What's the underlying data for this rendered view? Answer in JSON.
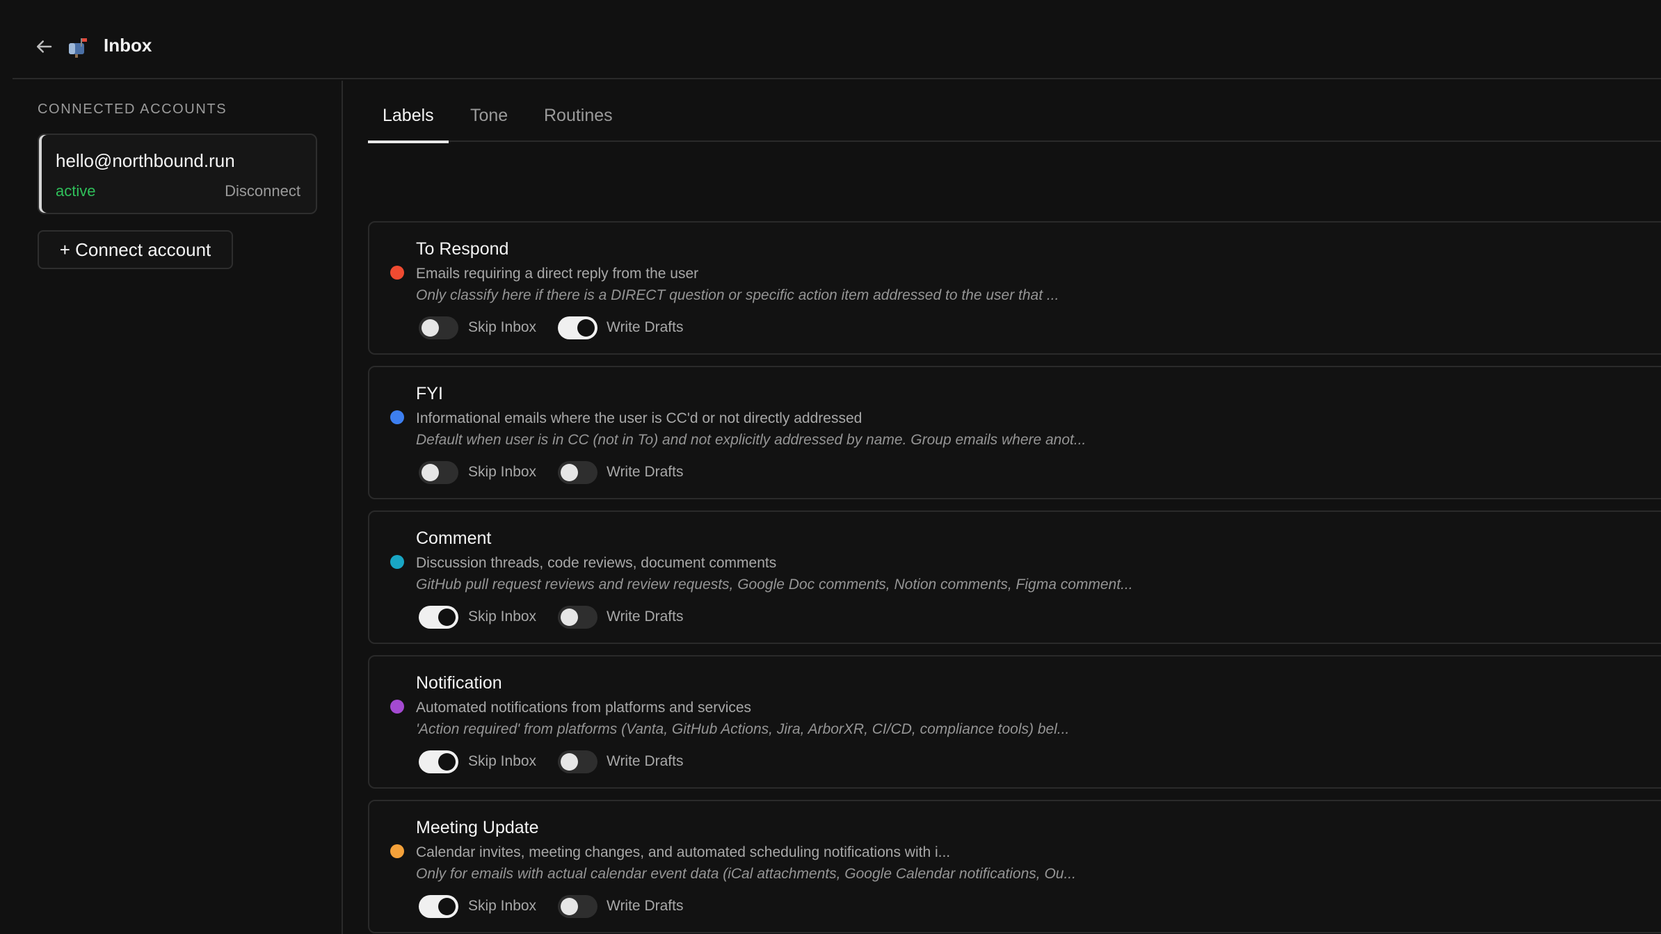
{
  "header": {
    "title": "Inbox",
    "back_icon": "arrow-left-icon",
    "app_icon": "mailbox-icon"
  },
  "sidebar": {
    "section_label": "CONNECTED ACCOUNTS",
    "account": {
      "email": "hello@northbound.run",
      "status": "active",
      "disconnect_label": "Disconnect"
    },
    "connect_button_label": "+ Connect account"
  },
  "tabs": [
    {
      "label": "Labels",
      "active": true
    },
    {
      "label": "Tone",
      "active": false
    },
    {
      "label": "Routines",
      "active": false
    }
  ],
  "toggle_labels": {
    "skip_inbox": "Skip Inbox",
    "write_drafts": "Write Drafts"
  },
  "labels": [
    {
      "title": "To Respond",
      "color": "#ef4b31",
      "description": "Emails requiring a direct reply from the user",
      "note": "Only classify here if there is a DIRECT question or specific action item addressed to the user that ...",
      "skip_inbox": false,
      "write_drafts": true
    },
    {
      "title": "FYI",
      "color": "#3d7ff0",
      "description": "Informational emails where the user is CC'd or not directly addressed",
      "note": "Default when user is in CC (not in To) and not explicitly addressed by name. Group emails where anot...",
      "skip_inbox": false,
      "write_drafts": false
    },
    {
      "title": "Comment",
      "color": "#19a6c4",
      "description": "Discussion threads, code reviews, document comments",
      "note": "GitHub pull request reviews and review requests, Google Doc comments, Notion comments, Figma comment...",
      "skip_inbox": true,
      "write_drafts": false
    },
    {
      "title": "Notification",
      "color": "#a44ad1",
      "description": "Automated notifications from platforms and services",
      "note": "'Action required' from platforms (Vanta, GitHub Actions, Jira, ArborXR, CI/CD, compliance tools) bel...",
      "skip_inbox": true,
      "write_drafts": false
    },
    {
      "title": "Meeting Update",
      "color": "#f4a13a",
      "description": "Calendar invites, meeting changes, and automated scheduling notifications with i...",
      "note": "Only for emails with actual calendar event data (iCal attachments, Google Calendar notifications, Ou...",
      "skip_inbox": true,
      "write_drafts": false
    }
  ]
}
